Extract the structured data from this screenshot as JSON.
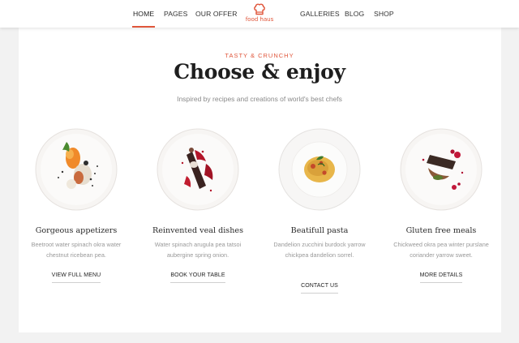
{
  "nav": {
    "left_items": [
      "HOME",
      "PAGES",
      "OUR OFFER"
    ],
    "right_items": [
      "GALLERIES",
      "BLOG",
      "SHOP"
    ],
    "active": "HOME",
    "logo_text": "food haus",
    "accent_color": "#e0563b"
  },
  "hero": {
    "eyebrow": "TASTY & CRUNCHY",
    "title": "Choose & enjoy",
    "subtitle": "Inspired by recipes and creations of world's best chefs"
  },
  "dishes": [
    {
      "name": "Gorgeous appetizers",
      "description": "Beetroot water spinach okra water chestnut ricebean pea.",
      "link": "VIEW FULL MENU",
      "image_icon": "appetizer-plate-icon"
    },
    {
      "name": "Reinvented veal dishes",
      "description": "Water spinach arugula pea tatsoi aubergine spring onion.",
      "link": "BOOK YOUR TABLE",
      "image_icon": "veal-plate-icon"
    },
    {
      "name": "Beatifull pasta",
      "description": "Dandelion zucchini burdock yarrow chickpea dandelion sorrel.",
      "link": "CONTACT US",
      "image_icon": "pasta-plate-icon"
    },
    {
      "name": "Gluten free meals",
      "description": "Chickweed okra pea winter purslane coriander yarrow sweet.",
      "link": "MORE DETAILS",
      "image_icon": "gluten-free-plate-icon"
    }
  ]
}
